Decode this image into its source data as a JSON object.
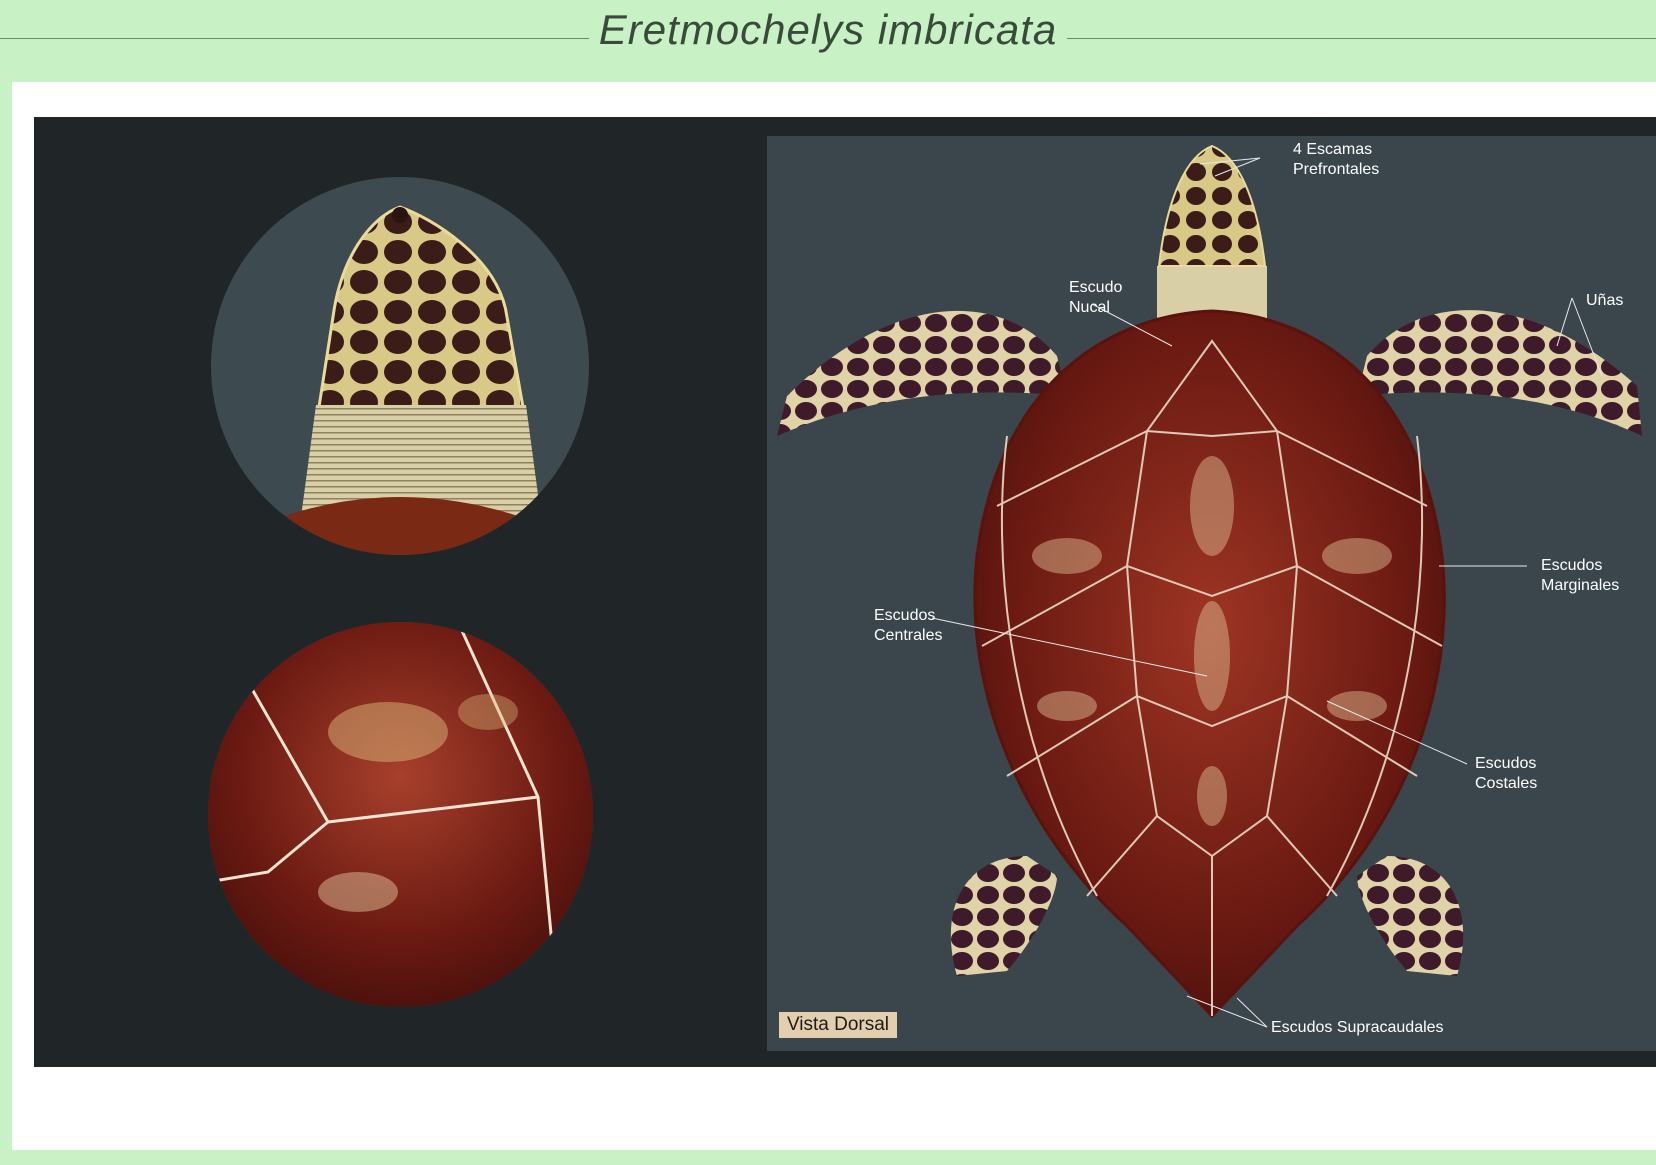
{
  "title": "Eretmochelys imbricata",
  "view_badge": "Vista Dorsal",
  "labels": {
    "prefrontales": "4 Escamas\nPrefrontales",
    "nucal": "Escudo\nNucal",
    "unas": "Uñas",
    "marginales": "Escudos\nMarginales",
    "centrales": "Escudos\nCentrales",
    "costales": "Escudos\nCostales",
    "supracaudales": "Escudos Supracaudales"
  },
  "colors": {
    "background": "#c8f1c6",
    "panel": "#202628",
    "illustration_bg": "#3a464c",
    "shell": "#6b1a12",
    "badge": "#e3cfae"
  }
}
